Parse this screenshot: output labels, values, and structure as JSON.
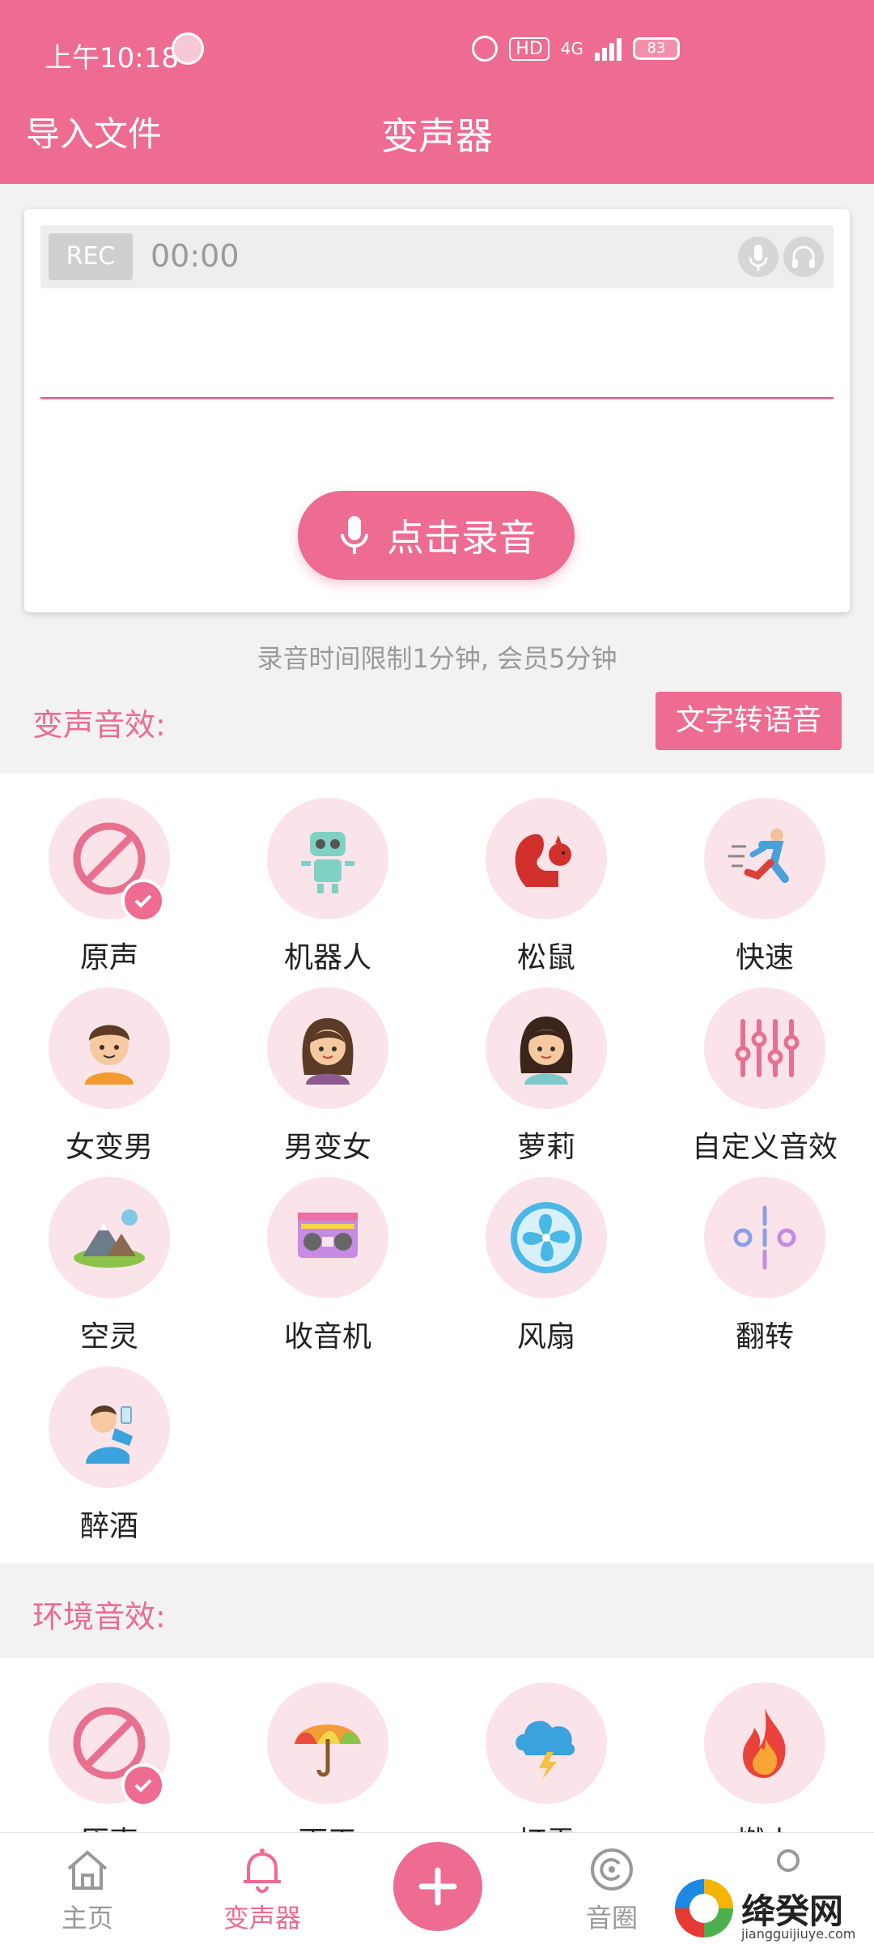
{
  "status_bar": {
    "time": "上午10:18",
    "hd": "HD",
    "network": "4G",
    "battery": "83"
  },
  "header": {
    "import_label": "导入文件",
    "title": "变声器"
  },
  "recorder": {
    "rec_badge": "REC",
    "timer": "00:00",
    "record_button_label": "点击录音",
    "limit_hint": "录音时间限制1分钟, 会员5分钟"
  },
  "voice_section": {
    "title": "变声音效:",
    "tts_button": "文字转语音",
    "items": [
      {
        "label": "原声",
        "icon": "no-effect-icon",
        "selected": true
      },
      {
        "label": "机器人",
        "icon": "robot-icon"
      },
      {
        "label": "松鼠",
        "icon": "squirrel-icon"
      },
      {
        "label": "快速",
        "icon": "running-man-icon"
      },
      {
        "label": "女变男",
        "icon": "boy-face-icon"
      },
      {
        "label": "男变女",
        "icon": "woman-face-icon"
      },
      {
        "label": "萝莉",
        "icon": "girl-face-icon"
      },
      {
        "label": "自定义音效",
        "icon": "equalizer-sliders-icon"
      },
      {
        "label": "空灵",
        "icon": "mountain-landscape-icon"
      },
      {
        "label": "收音机",
        "icon": "radio-icon"
      },
      {
        "label": "风扇",
        "icon": "fan-icon"
      },
      {
        "label": "翻转",
        "icon": "reverse-icon"
      },
      {
        "label": "醉酒",
        "icon": "drinking-man-icon"
      }
    ]
  },
  "env_section": {
    "title": "环境音效:",
    "items": [
      {
        "label": "原声",
        "icon": "no-effect-icon",
        "selected": true
      },
      {
        "label": "雨天",
        "icon": "umbrella-icon"
      },
      {
        "label": "打雷",
        "icon": "thunder-cloud-icon"
      },
      {
        "label": "燃火",
        "icon": "fire-icon"
      }
    ]
  },
  "bottom_nav": {
    "home": "主页",
    "voice_changer": "变声器",
    "sound_circle": "音圈"
  },
  "watermark": {
    "name": "绛癸网",
    "url": "jiangguijiuye.com"
  },
  "colors": {
    "accent": "#ee6b91",
    "icon_bg": "#fbe3ea"
  }
}
